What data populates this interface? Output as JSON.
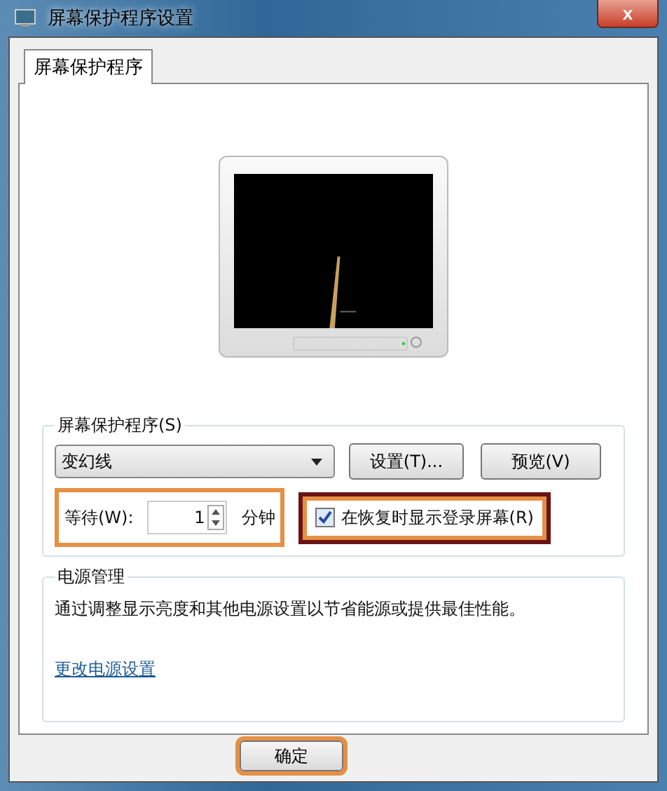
{
  "window": {
    "title": "屏幕保护程序设置",
    "close": "x"
  },
  "tabs": [
    {
      "label": "屏幕保护程序",
      "selected": true
    }
  ],
  "screensaver": {
    "legend": "屏幕保护程序(S)",
    "dropdown": "变幻线",
    "settings_button": "设置(T)...",
    "preview_button": "预览(V)",
    "wait": {
      "label": "等待(W):",
      "value": "1",
      "unit": "分钟",
      "highlighted": true
    },
    "login": {
      "label": "在恢复时显示登录屏幕(R)",
      "checked": true,
      "highlighted": true
    }
  },
  "power": {
    "legend": "电源管理",
    "description": "通过调整显示亮度和其他电源设置以节省能源或提供最佳性能。",
    "link": "更改电源设置"
  },
  "buttons": [
    {
      "label": "确定",
      "highlighted": true
    }
  ]
}
